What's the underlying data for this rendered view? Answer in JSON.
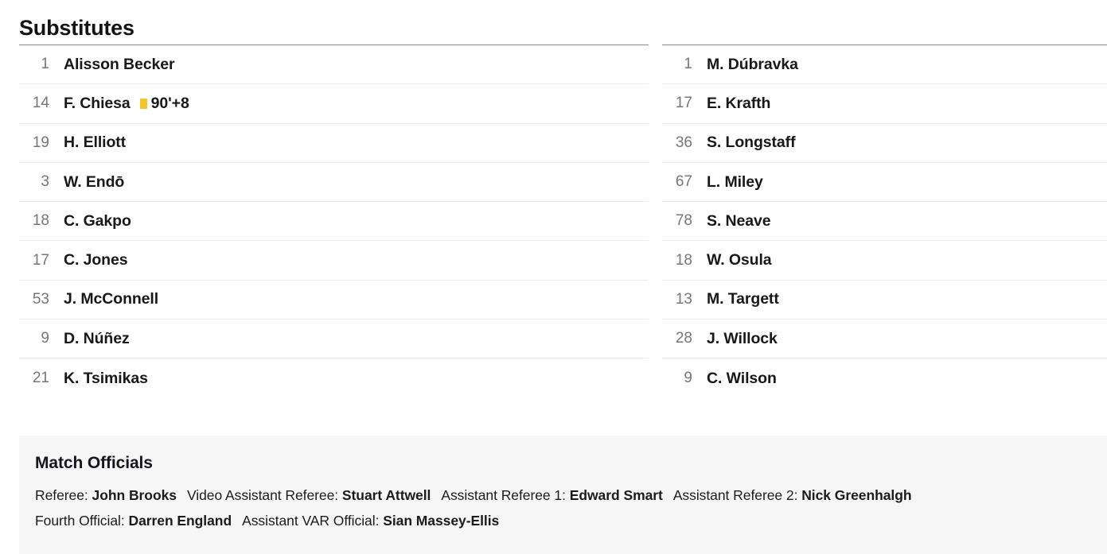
{
  "section": {
    "title": "Substitutes"
  },
  "substitutes": {
    "home": [
      {
        "number": "1",
        "name": "Alisson Becker",
        "events": []
      },
      {
        "number": "14",
        "name": "F. Chiesa",
        "events": [
          {
            "icon": "yellow-card-icon",
            "time": "90'+8"
          }
        ]
      },
      {
        "number": "19",
        "name": "H. Elliott",
        "events": []
      },
      {
        "number": "3",
        "name": "W. Endō",
        "events": []
      },
      {
        "number": "18",
        "name": "C. Gakpo",
        "events": []
      },
      {
        "number": "17",
        "name": "C. Jones",
        "events": []
      },
      {
        "number": "53",
        "name": "J. McConnell",
        "events": []
      },
      {
        "number": "9",
        "name": "D. Núñez",
        "events": []
      },
      {
        "number": "21",
        "name": "K. Tsimikas",
        "events": []
      }
    ],
    "away": [
      {
        "number": "1",
        "name": "M. Dúbravka",
        "events": []
      },
      {
        "number": "17",
        "name": "E. Krafth",
        "events": []
      },
      {
        "number": "36",
        "name": "S. Longstaff",
        "events": []
      },
      {
        "number": "67",
        "name": "L. Miley",
        "events": []
      },
      {
        "number": "78",
        "name": "S. Neave",
        "events": []
      },
      {
        "number": "18",
        "name": "W. Osula",
        "events": []
      },
      {
        "number": "13",
        "name": "M. Targett",
        "events": []
      },
      {
        "number": "28",
        "name": "J. Willock",
        "events": []
      },
      {
        "number": "9",
        "name": "C. Wilson",
        "events": []
      }
    ]
  },
  "match_officials": {
    "title": "Match Officials",
    "lines": [
      [
        {
          "role": "Referee:",
          "name": "John Brooks"
        },
        {
          "role": "Video Assistant Referee:",
          "name": "Stuart Attwell"
        },
        {
          "role": "Assistant Referee 1:",
          "name": "Edward Smart"
        },
        {
          "role": "Assistant Referee 2:",
          "name": "Nick Greenhalgh"
        }
      ],
      [
        {
          "role": "Fourth Official:",
          "name": "Darren England"
        },
        {
          "role": "Assistant VAR Official:",
          "name": "Sian Massey-Ellis"
        }
      ]
    ]
  },
  "colors": {
    "yellow_card": "#f5c523",
    "number_gray": "#767676",
    "name_dark": "#18181a",
    "officials_bg": "#f6f6f6",
    "divider": "#eaeaea",
    "top_rule": "#8c8c8c"
  }
}
